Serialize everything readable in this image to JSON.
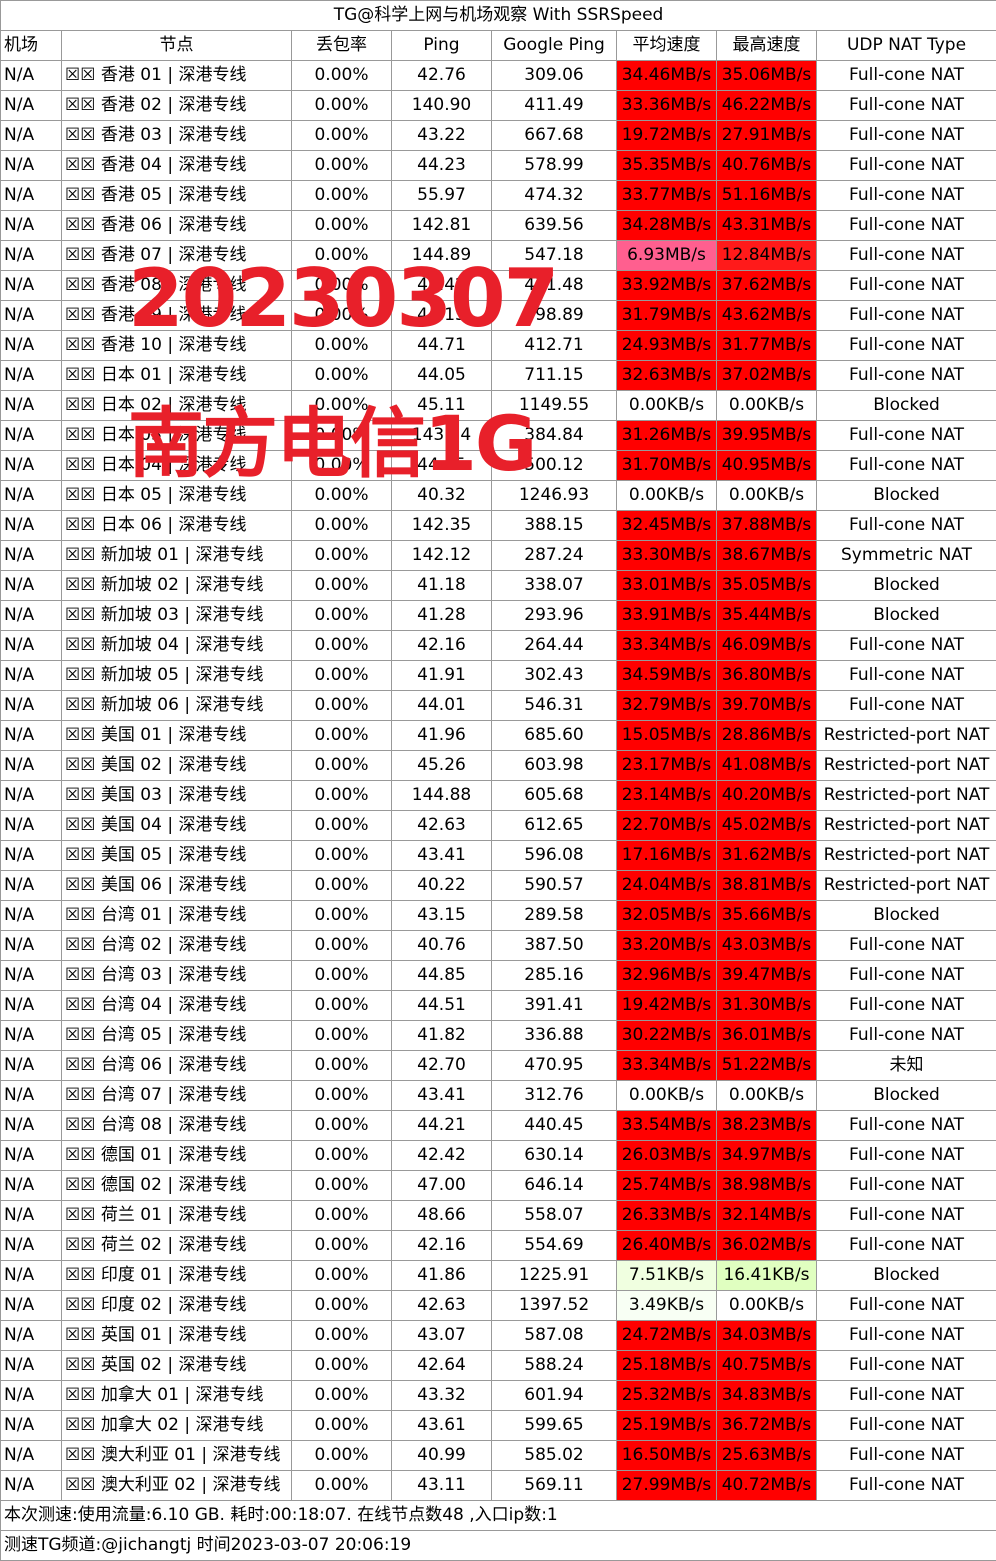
{
  "title": "TG@科学上网与机场观察 With SSRSpeed",
  "headers": [
    "机场",
    "节点",
    "丢包率",
    "Ping",
    "Google Ping",
    "平均速度",
    "最高速度",
    "UDP NAT Type"
  ],
  "colors": {
    "red": "#ff0000",
    "red2": "#ff1a1a",
    "pink": "#ff5f8f",
    "green1": "#f0ffe0",
    "green2": "#e0ffc0",
    "green3": "#f8fff4",
    "white": "#ffffff"
  },
  "rows": [
    [
      "N/A",
      "☒☒ 香港 01 | 深港专线",
      "0.00%",
      "42.76",
      "309.06",
      "34.46MB/s",
      "35.06MB/s",
      "Full-cone NAT",
      "red",
      "red"
    ],
    [
      "N/A",
      "☒☒ 香港 02 | 深港专线",
      "0.00%",
      "140.90",
      "411.49",
      "33.36MB/s",
      "46.22MB/s",
      "Full-cone NAT",
      "red",
      "red"
    ],
    [
      "N/A",
      "☒☒ 香港 03 | 深港专线",
      "0.00%",
      "43.22",
      "667.68",
      "19.72MB/s",
      "27.91MB/s",
      "Full-cone NAT",
      "red",
      "red"
    ],
    [
      "N/A",
      "☒☒ 香港 04 | 深港专线",
      "0.00%",
      "44.23",
      "578.99",
      "35.35MB/s",
      "40.76MB/s",
      "Full-cone NAT",
      "red",
      "red"
    ],
    [
      "N/A",
      "☒☒ 香港 05 | 深港专线",
      "0.00%",
      "55.97",
      "474.32",
      "33.77MB/s",
      "51.16MB/s",
      "Full-cone NAT",
      "red",
      "red"
    ],
    [
      "N/A",
      "☒☒ 香港 06 | 深港专线",
      "0.00%",
      "142.81",
      "639.56",
      "34.28MB/s",
      "43.31MB/s",
      "Full-cone NAT",
      "red",
      "red"
    ],
    [
      "N/A",
      "☒☒ 香港 07 | 深港专线",
      "0.00%",
      "144.89",
      "547.18",
      "6.93MB/s",
      "12.84MB/s",
      "Full-cone NAT",
      "pink",
      "red2"
    ],
    [
      "N/A",
      "☒☒ 香港 08 | 深港专线",
      "0.00%",
      "42.42",
      "471.48",
      "33.92MB/s",
      "37.62MB/s",
      "Full-cone NAT",
      "red",
      "red"
    ],
    [
      "N/A",
      "☒☒ 香港 09 | 深港专线",
      "0.00%",
      "44.15",
      "598.89",
      "31.79MB/s",
      "43.62MB/s",
      "Full-cone NAT",
      "red",
      "red"
    ],
    [
      "N/A",
      "☒☒ 香港 10 | 深港专线",
      "0.00%",
      "44.71",
      "412.71",
      "24.93MB/s",
      "31.77MB/s",
      "Full-cone NAT",
      "red",
      "red"
    ],
    [
      "N/A",
      "☒☒ 日本 01 | 深港专线",
      "0.00%",
      "44.05",
      "711.15",
      "32.63MB/s",
      "37.02MB/s",
      "Full-cone NAT",
      "red",
      "red"
    ],
    [
      "N/A",
      "☒☒ 日本 02 | 深港专线",
      "0.00%",
      "45.11",
      "1149.55",
      "0.00KB/s",
      "0.00KB/s",
      "Blocked",
      "white",
      "white"
    ],
    [
      "N/A",
      "☒☒ 日本 03 | 深港专线",
      "0.00%",
      "143.14",
      "384.84",
      "31.26MB/s",
      "39.95MB/s",
      "Full-cone NAT",
      "red",
      "red"
    ],
    [
      "N/A",
      "☒☒ 日本 04 | 深港专线",
      "0.00%",
      "44.95",
      "500.12",
      "31.70MB/s",
      "40.95MB/s",
      "Full-cone NAT",
      "red",
      "red"
    ],
    [
      "N/A",
      "☒☒ 日本 05 | 深港专线",
      "0.00%",
      "40.32",
      "1246.93",
      "0.00KB/s",
      "0.00KB/s",
      "Blocked",
      "white",
      "white"
    ],
    [
      "N/A",
      "☒☒ 日本 06 | 深港专线",
      "0.00%",
      "142.35",
      "388.15",
      "32.45MB/s",
      "37.88MB/s",
      "Full-cone NAT",
      "red",
      "red"
    ],
    [
      "N/A",
      "☒☒ 新加坡 01 | 深港专线",
      "0.00%",
      "142.12",
      "287.24",
      "33.30MB/s",
      "38.67MB/s",
      "Symmetric NAT",
      "red",
      "red"
    ],
    [
      "N/A",
      "☒☒ 新加坡 02 | 深港专线",
      "0.00%",
      "41.18",
      "338.07",
      "33.01MB/s",
      "35.05MB/s",
      "Blocked",
      "red",
      "red"
    ],
    [
      "N/A",
      "☒☒ 新加坡 03 | 深港专线",
      "0.00%",
      "41.28",
      "293.96",
      "33.91MB/s",
      "35.44MB/s",
      "Blocked",
      "red",
      "red"
    ],
    [
      "N/A",
      "☒☒ 新加坡 04 | 深港专线",
      "0.00%",
      "42.16",
      "264.44",
      "33.34MB/s",
      "46.09MB/s",
      "Full-cone NAT",
      "red",
      "red"
    ],
    [
      "N/A",
      "☒☒ 新加坡 05 | 深港专线",
      "0.00%",
      "41.91",
      "302.43",
      "34.59MB/s",
      "36.80MB/s",
      "Full-cone NAT",
      "red",
      "red"
    ],
    [
      "N/A",
      "☒☒ 新加坡 06 | 深港专线",
      "0.00%",
      "44.01",
      "546.31",
      "32.79MB/s",
      "39.70MB/s",
      "Full-cone NAT",
      "red",
      "red"
    ],
    [
      "N/A",
      "☒☒ 美国 01 | 深港专线",
      "0.00%",
      "41.96",
      "685.60",
      "15.05MB/s",
      "28.86MB/s",
      "Restricted-port NAT",
      "red",
      "red"
    ],
    [
      "N/A",
      "☒☒ 美国 02 | 深港专线",
      "0.00%",
      "45.26",
      "603.98",
      "23.17MB/s",
      "41.08MB/s",
      "Restricted-port NAT",
      "red",
      "red"
    ],
    [
      "N/A",
      "☒☒ 美国 03 | 深港专线",
      "0.00%",
      "144.88",
      "605.68",
      "23.14MB/s",
      "40.20MB/s",
      "Restricted-port NAT",
      "red",
      "red"
    ],
    [
      "N/A",
      "☒☒ 美国 04 | 深港专线",
      "0.00%",
      "42.63",
      "612.65",
      "22.70MB/s",
      "45.02MB/s",
      "Restricted-port NAT",
      "red",
      "red"
    ],
    [
      "N/A",
      "☒☒ 美国 05 | 深港专线",
      "0.00%",
      "43.41",
      "596.08",
      "17.16MB/s",
      "31.62MB/s",
      "Restricted-port NAT",
      "red",
      "red"
    ],
    [
      "N/A",
      "☒☒ 美国 06 | 深港专线",
      "0.00%",
      "40.22",
      "590.57",
      "24.04MB/s",
      "38.81MB/s",
      "Restricted-port NAT",
      "red",
      "red"
    ],
    [
      "N/A",
      "☒☒ 台湾 01 | 深港专线",
      "0.00%",
      "43.15",
      "289.58",
      "32.05MB/s",
      "35.66MB/s",
      "Blocked",
      "red",
      "red"
    ],
    [
      "N/A",
      "☒☒ 台湾 02 | 深港专线",
      "0.00%",
      "40.76",
      "387.50",
      "33.20MB/s",
      "43.03MB/s",
      "Full-cone NAT",
      "red",
      "red"
    ],
    [
      "N/A",
      "☒☒ 台湾 03 | 深港专线",
      "0.00%",
      "44.85",
      "285.16",
      "32.96MB/s",
      "39.47MB/s",
      "Full-cone NAT",
      "red",
      "red"
    ],
    [
      "N/A",
      "☒☒ 台湾 04 | 深港专线",
      "0.00%",
      "44.51",
      "391.41",
      "19.42MB/s",
      "31.30MB/s",
      "Full-cone NAT",
      "red",
      "red"
    ],
    [
      "N/A",
      "☒☒ 台湾 05 | 深港专线",
      "0.00%",
      "41.82",
      "336.88",
      "30.22MB/s",
      "36.01MB/s",
      "Full-cone NAT",
      "red",
      "red"
    ],
    [
      "N/A",
      "☒☒ 台湾 06 | 深港专线",
      "0.00%",
      "42.70",
      "470.95",
      "33.34MB/s",
      "51.22MB/s",
      "未知",
      "red",
      "red"
    ],
    [
      "N/A",
      "☒☒ 台湾 07 | 深港专线",
      "0.00%",
      "43.41",
      "312.76",
      "0.00KB/s",
      "0.00KB/s",
      "Blocked",
      "white",
      "white"
    ],
    [
      "N/A",
      "☒☒ 台湾 08 | 深港专线",
      "0.00%",
      "44.21",
      "440.45",
      "33.54MB/s",
      "38.23MB/s",
      "Full-cone NAT",
      "red",
      "red"
    ],
    [
      "N/A",
      "☒☒ 德国 01 | 深港专线",
      "0.00%",
      "42.42",
      "630.14",
      "26.03MB/s",
      "34.97MB/s",
      "Full-cone NAT",
      "red",
      "red"
    ],
    [
      "N/A",
      "☒☒ 德国 02 | 深港专线",
      "0.00%",
      "47.00",
      "646.14",
      "25.74MB/s",
      "38.98MB/s",
      "Full-cone NAT",
      "red",
      "red"
    ],
    [
      "N/A",
      "☒☒ 荷兰 01 | 深港专线",
      "0.00%",
      "48.66",
      "558.07",
      "26.33MB/s",
      "32.14MB/s",
      "Full-cone NAT",
      "red",
      "red"
    ],
    [
      "N/A",
      "☒☒ 荷兰 02 | 深港专线",
      "0.00%",
      "42.16",
      "554.69",
      "26.40MB/s",
      "36.02MB/s",
      "Full-cone NAT",
      "red",
      "red"
    ],
    [
      "N/A",
      "☒☒ 印度 01 | 深港专线",
      "0.00%",
      "41.86",
      "1225.91",
      "7.51KB/s",
      "16.41KB/s",
      "Blocked",
      "green1",
      "green2"
    ],
    [
      "N/A",
      "☒☒ 印度 02 | 深港专线",
      "0.00%",
      "42.63",
      "1397.52",
      "3.49KB/s",
      "0.00KB/s",
      "Full-cone NAT",
      "green3",
      "white"
    ],
    [
      "N/A",
      "☒☒ 英国 01 | 深港专线",
      "0.00%",
      "43.07",
      "587.08",
      "24.72MB/s",
      "34.03MB/s",
      "Full-cone NAT",
      "red",
      "red"
    ],
    [
      "N/A",
      "☒☒ 英国 02 | 深港专线",
      "0.00%",
      "42.64",
      "588.24",
      "25.18MB/s",
      "40.75MB/s",
      "Full-cone NAT",
      "red",
      "red"
    ],
    [
      "N/A",
      "☒☒ 加拿大 01 | 深港专线",
      "0.00%",
      "43.32",
      "601.94",
      "25.32MB/s",
      "34.83MB/s",
      "Full-cone NAT",
      "red",
      "red"
    ],
    [
      "N/A",
      "☒☒ 加拿大 02 | 深港专线",
      "0.00%",
      "43.61",
      "599.65",
      "25.19MB/s",
      "36.72MB/s",
      "Full-cone NAT",
      "red",
      "red"
    ],
    [
      "N/A",
      "☒☒ 澳大利亚 01 | 深港专线",
      "0.00%",
      "40.99",
      "585.02",
      "16.50MB/s",
      "25.63MB/s",
      "Full-cone NAT",
      "red",
      "red"
    ],
    [
      "N/A",
      "☒☒ 澳大利亚 02 | 深港专线",
      "0.00%",
      "43.11",
      "569.11",
      "27.99MB/s",
      "40.72MB/s",
      "Full-cone NAT",
      "red",
      "red"
    ]
  ],
  "footer": [
    "本次测速:使用流量:6.10 GB. 耗时:00:18:07. 在线节点数48 ,入口ip数:1",
    "测速TG频道:@jichangtj 时间2023-03-07 20:06:19"
  ],
  "watermark": [
    "20230307",
    "南方电信1G"
  ]
}
